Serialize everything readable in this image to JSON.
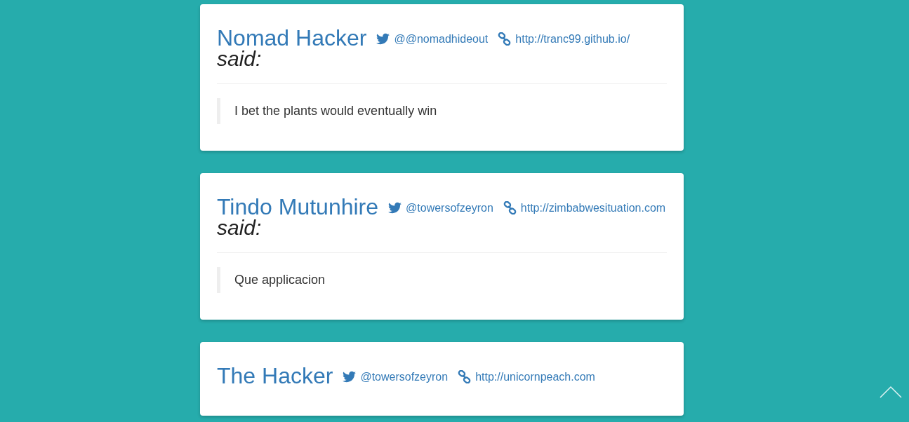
{
  "comments": [
    {
      "name": "Nomad Hacker",
      "twitter": "@@nomadhideout",
      "website": "http://tranc99.github.io/",
      "said": "said:",
      "quote": "I bet the plants would eventually win"
    },
    {
      "name": "Tindo Mutunhire",
      "twitter": "@towersofzeyron",
      "website": "http://zimbabwesituation.com",
      "said": "said:",
      "quote": "Que applicacion"
    },
    {
      "name": "The Hacker",
      "twitter": "@towersofzeyron",
      "website": "http://unicornpeach.com"
    }
  ]
}
